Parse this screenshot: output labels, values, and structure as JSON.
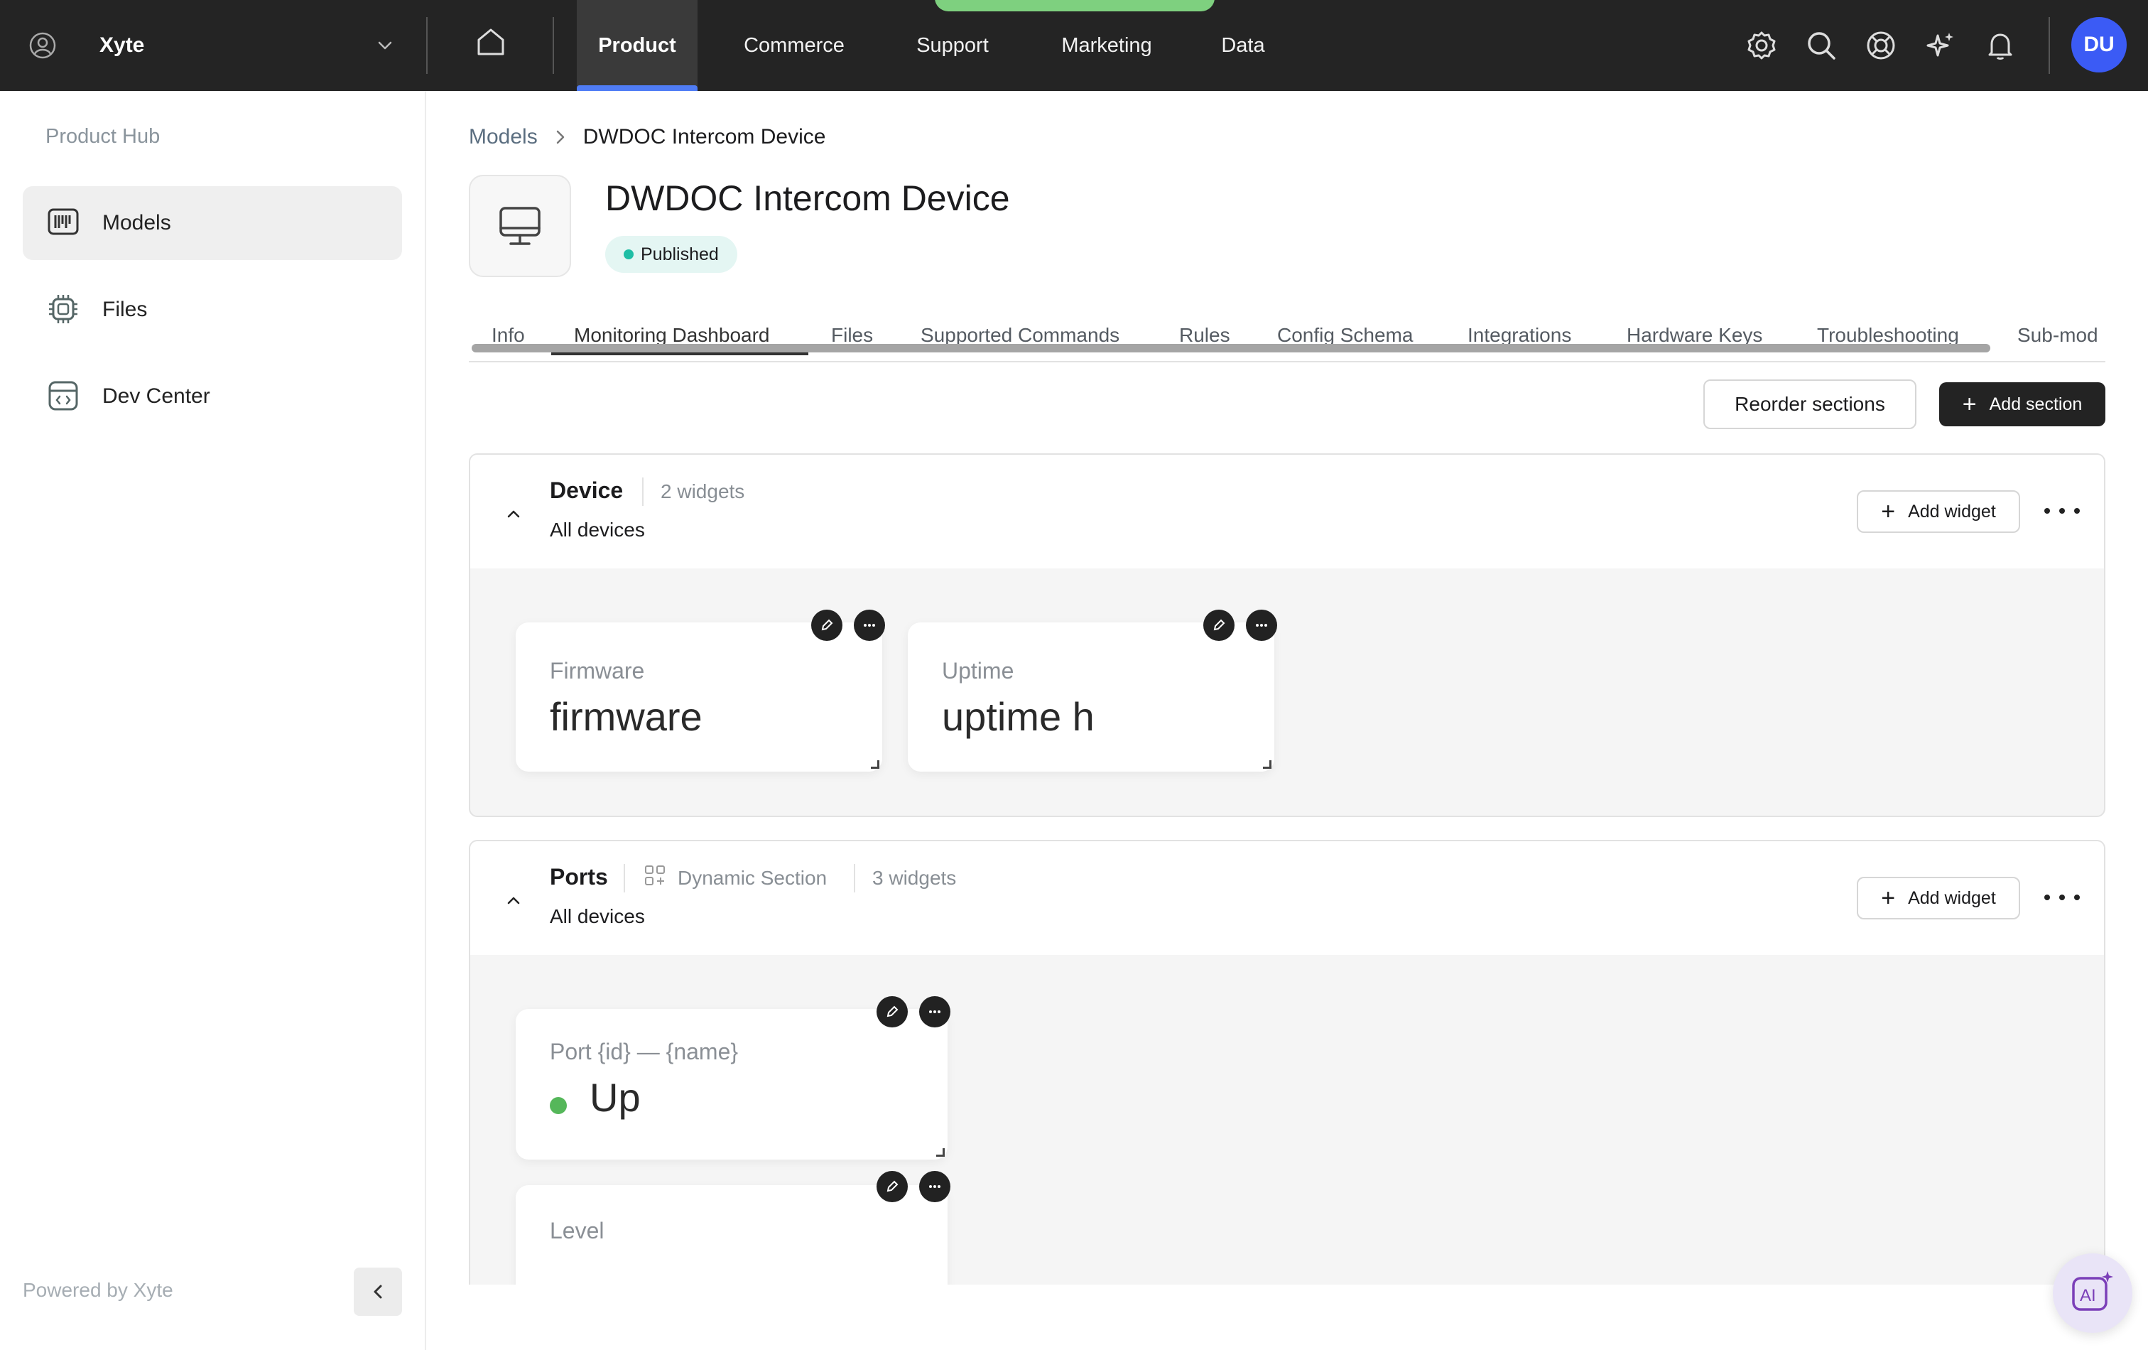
{
  "app": {
    "org_name": "Xyte",
    "nav": [
      "Product",
      "Commerce",
      "Support",
      "Marketing",
      "Data"
    ],
    "active_nav": "Product",
    "user_initials": "DU",
    "colors": {
      "topbar": "#242424",
      "accent": "#4f7cf5",
      "avatar": "#3b5bf5",
      "published": "#1ebea5"
    }
  },
  "sidebar": {
    "title": "Product Hub",
    "items": [
      {
        "label": "Models",
        "icon": "barcode-icon",
        "active": true
      },
      {
        "label": "Files",
        "icon": "chip-icon",
        "active": false
      },
      {
        "label": "Dev Center",
        "icon": "code-window-icon",
        "active": false
      }
    ],
    "footer": "Powered by Xyte"
  },
  "breadcrumb": {
    "parent": "Models",
    "current": "DWDOC Intercom Device"
  },
  "model": {
    "title": "DWDOC Intercom Device",
    "status": "Published"
  },
  "tabs": [
    "Info",
    "Monitoring Dashboard",
    "Files",
    "Supported Commands",
    "Rules",
    "Config Schema",
    "Integrations",
    "Hardware Keys",
    "Troubleshooting",
    "Sub-mod"
  ],
  "active_tab": "Monitoring Dashboard",
  "actions": {
    "reorder": "Reorder sections",
    "add_section": "Add section"
  },
  "sections": [
    {
      "title": "Device",
      "widgets_count": "2 widgets",
      "scope": "All devices",
      "add_widget": "Add widget",
      "widgets": [
        {
          "label": "Firmware",
          "value": "firmware"
        },
        {
          "label": "Uptime",
          "value": "uptime h"
        }
      ]
    },
    {
      "title": "Ports",
      "tag": "Dynamic Section",
      "widgets_count": "3 widgets",
      "scope": "All devices",
      "add_widget": "Add widget",
      "widgets": [
        {
          "label": "Port {id} — {name}",
          "value": "Up",
          "status_color": "#55b75a"
        },
        {
          "label": "Level",
          "value": ""
        }
      ]
    }
  ]
}
